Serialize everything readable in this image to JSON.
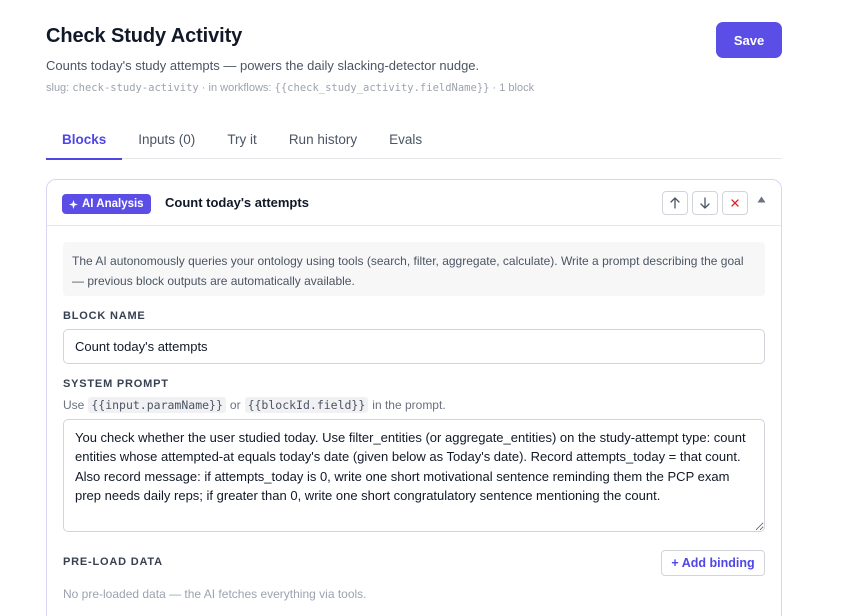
{
  "header": {
    "title": "Check Study Activity",
    "subtitle": "Counts today's study attempts — powers the daily slacking-detector nudge.",
    "slug_prefix": "slug: ",
    "slug": "check-study-activity",
    "workflows_prefix": " · in workflows: ",
    "workflows_ref": "{{check_study_activity.fieldName}}",
    "block_count": " · 1 block",
    "save_label": "Save"
  },
  "tabs": [
    {
      "label": "Blocks",
      "active": true
    },
    {
      "label": "Inputs (0)",
      "active": false
    },
    {
      "label": "Try it",
      "active": false
    },
    {
      "label": "Run history",
      "active": false
    },
    {
      "label": "Evals",
      "active": false
    }
  ],
  "block": {
    "badge_label": "AI Analysis",
    "badge_icon": "sparkle-icon",
    "title": "Count today's attempts",
    "info_text": "The AI autonomously queries your ontology using tools (search, filter, aggregate, calculate). Write a prompt describing the goal — previous block outputs are automatically available.",
    "name_label": "BLOCK NAME",
    "name_value": "Count today's attempts",
    "prompt_label": "SYSTEM PROMPT",
    "prompt_hint_use": "Use",
    "prompt_hint_chip1": "{{input.paramName}}",
    "prompt_hint_or": "or",
    "prompt_hint_chip2": "{{blockId.field}}",
    "prompt_hint_end": "in the prompt.",
    "prompt_value": "You check whether the user studied today. Use filter_entities (or aggregate_entities) on the study-attempt type: count entities whose attempted-at equals today's date (given below as Today's date). Record attempts_today = that count. Also record message: if attempts_today is 0, write one short motivational sentence reminding them the PCP exam prep needs daily reps; if greater than 0, write one short congratulatory sentence mentioning the count.",
    "preload_label": "PRE-LOAD DATA",
    "add_binding_label": "+ Add binding",
    "preload_empty": "No pre-loaded data — the AI fetches everything via tools."
  },
  "colors": {
    "accent": "#5b4ee6",
    "danger": "#dc2626"
  }
}
